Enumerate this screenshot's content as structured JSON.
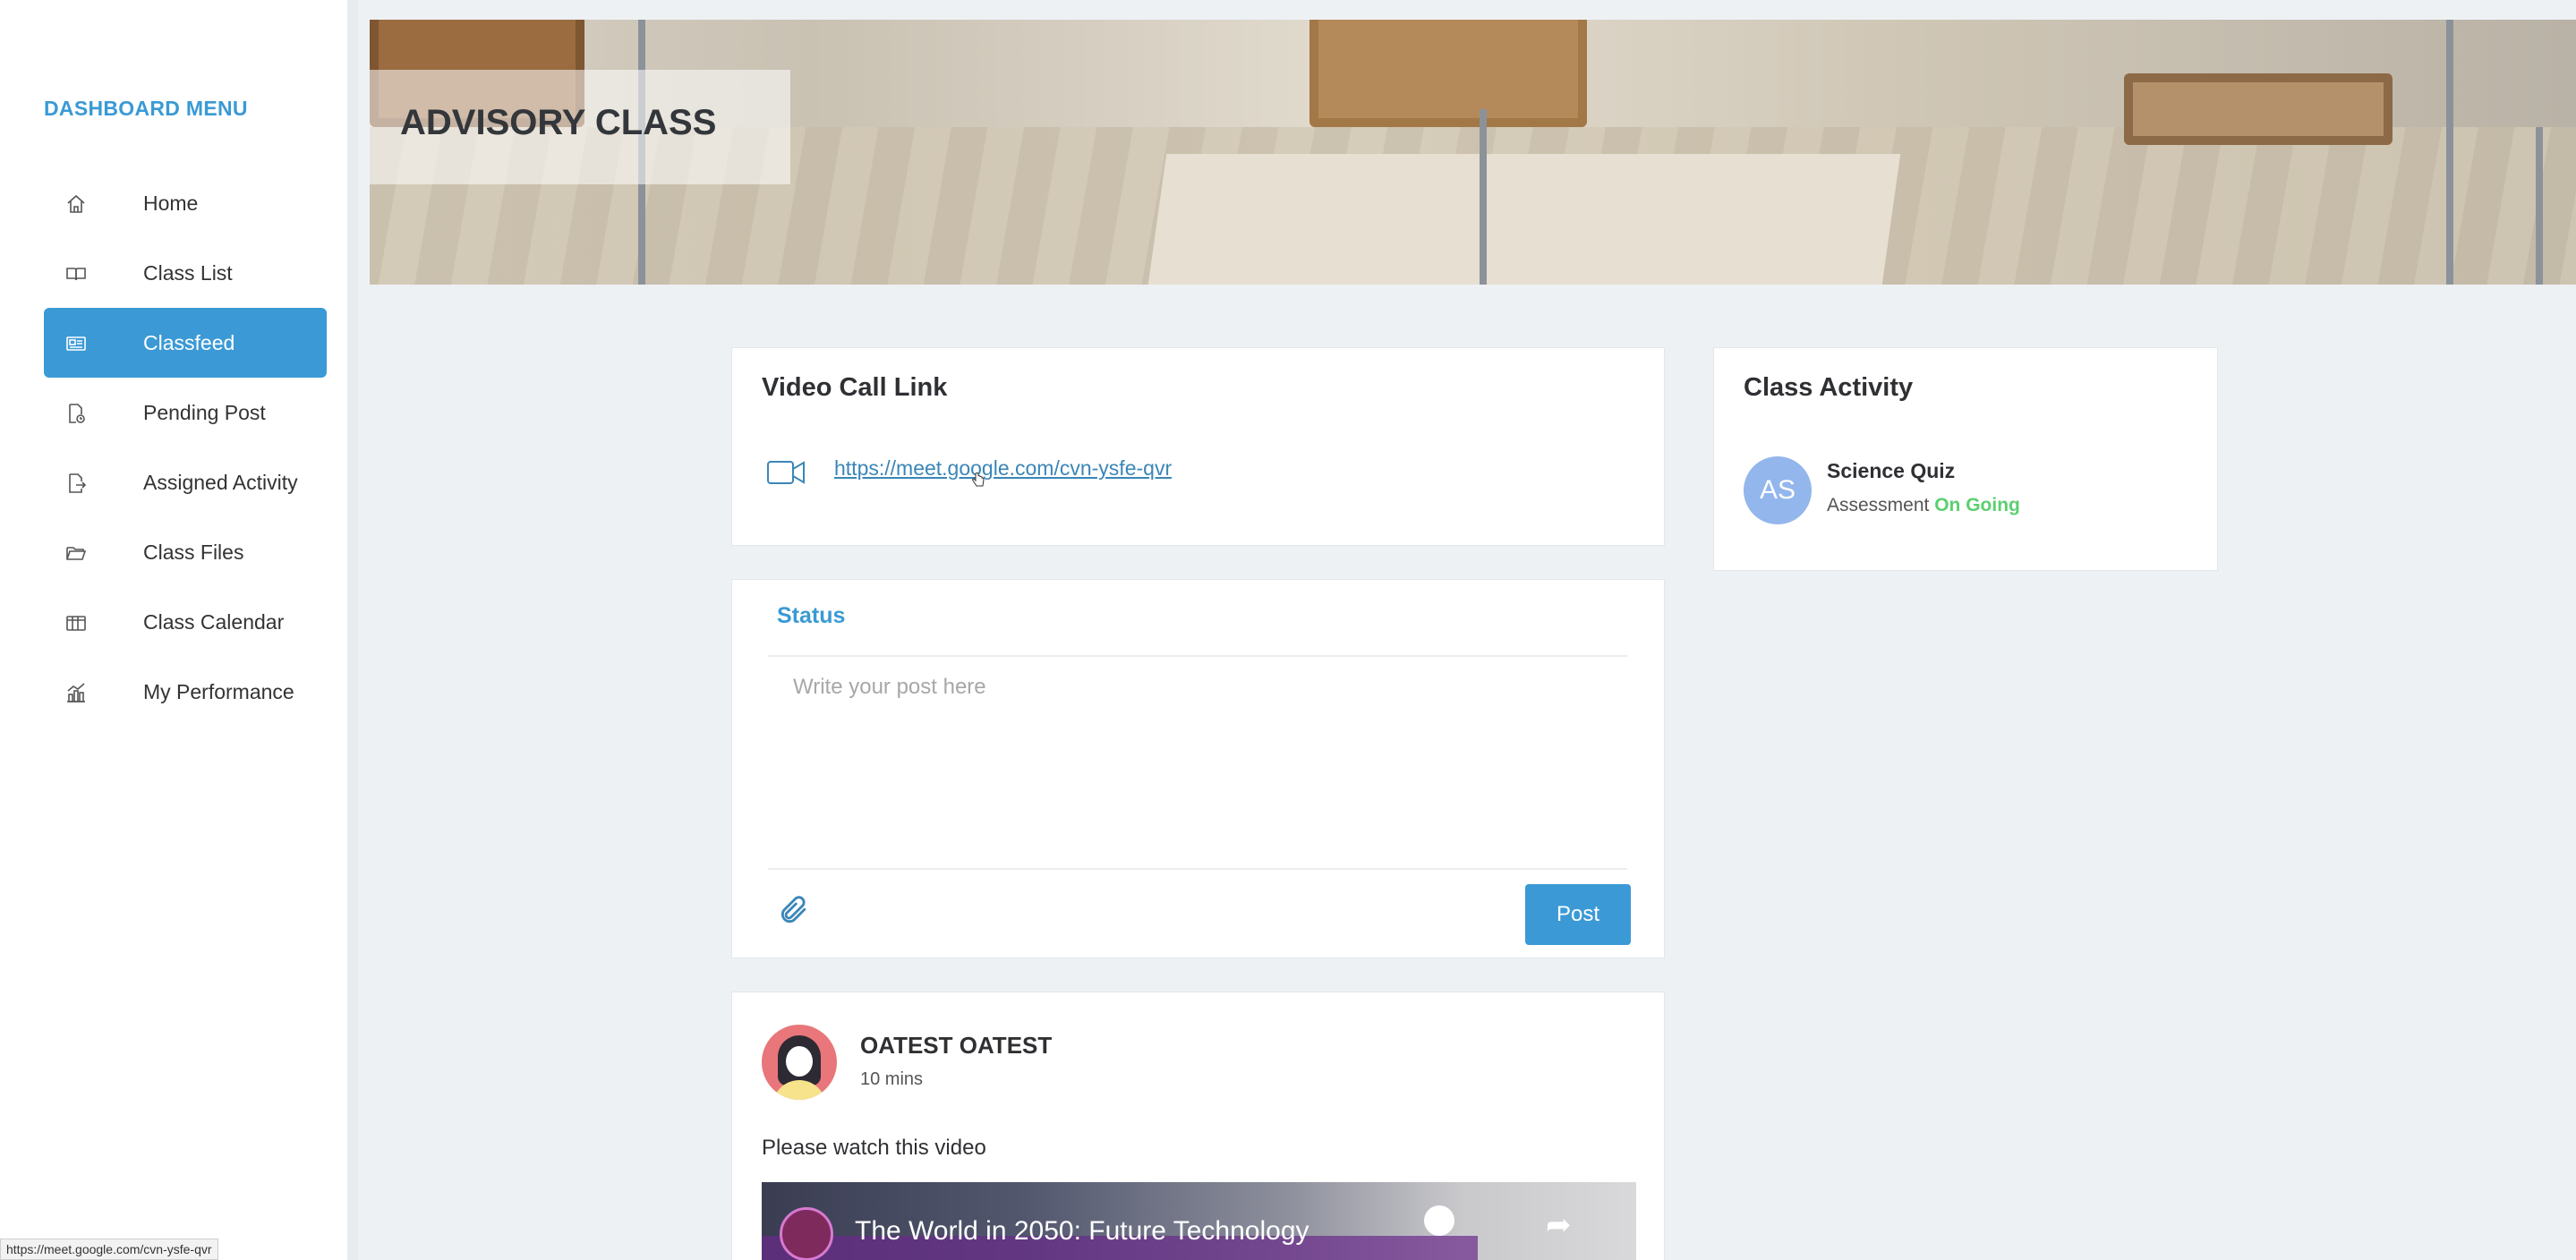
{
  "sidebar": {
    "title": "DASHBOARD MENU",
    "items": [
      {
        "label": "Home",
        "icon": "home-icon",
        "active": false
      },
      {
        "label": "Class List",
        "icon": "book-icon",
        "active": false
      },
      {
        "label": "Classfeed",
        "icon": "feed-icon",
        "active": true
      },
      {
        "label": "Pending Post",
        "icon": "pending-icon",
        "active": false
      },
      {
        "label": "Assigned Activity",
        "icon": "assigned-icon",
        "active": false
      },
      {
        "label": "Class Files",
        "icon": "folder-icon",
        "active": false
      },
      {
        "label": "Class Calendar",
        "icon": "calendar-icon",
        "active": false
      },
      {
        "label": "My Performance",
        "icon": "performance-icon",
        "active": false
      }
    ]
  },
  "banner": {
    "title": "ADVISORY CLASS"
  },
  "video_call": {
    "title": "Video Call Link",
    "link": "https://meet.google.com/cvn-ysfe-qvr"
  },
  "status": {
    "label": "Status",
    "placeholder": "Write your post here",
    "post_label": "Post"
  },
  "post": {
    "author": "OATEST OATEST",
    "time": "10 mins",
    "text": "Please watch this video",
    "video_title": "The World in 2050: Future Technology"
  },
  "class_activity": {
    "title": "Class Activity",
    "items": [
      {
        "initials": "AS",
        "name": "Science Quiz",
        "type": "Assessment",
        "status": "On Going"
      }
    ]
  },
  "status_bar": {
    "url": "https://meet.google.com/cvn-ysfe-qvr"
  },
  "colors": {
    "accent": "#3b9ad6",
    "ongoing": "#5ccf6f",
    "avatar": "#93b6ec"
  }
}
